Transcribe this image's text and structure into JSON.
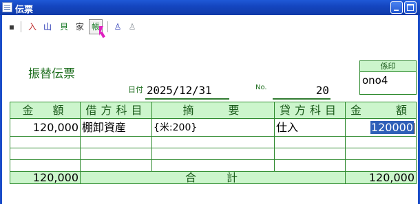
{
  "window": {
    "title": "伝票"
  },
  "toolbar": {
    "tools": [
      {
        "glyph": "▪",
        "icon": "new-sheet-icon"
      },
      {
        "glyph": "⼊",
        "icon": "entry-icon"
      },
      {
        "glyph": "⼭",
        "icon": "mountain-icon"
      },
      {
        "glyph": "⾙",
        "icon": "shell-icon"
      },
      {
        "glyph": "家",
        "icon": "house-icon"
      },
      {
        "glyph": "帳",
        "icon": "ledger-icon"
      },
      {
        "glyph": "♙",
        "icon": "user-icon"
      },
      {
        "glyph": "♙",
        "icon": "user-disabled-icon"
      }
    ]
  },
  "voucher": {
    "title": "振替伝票",
    "date_label": "日付",
    "date": "2025/12/31",
    "no_label": "No.",
    "number": "20",
    "stamp_label": "係印",
    "stamp_value": "ono4"
  },
  "table": {
    "headers": [
      "金　額",
      "借方科目",
      "摘　　要",
      "貸方科目",
      "金　　額"
    ],
    "rows": [
      {
        "debit_amount": "120,000",
        "debit_account": "棚卸資産",
        "description": "{米:200}",
        "credit_account": "仕入",
        "credit_amount": "120000"
      },
      {
        "debit_amount": "",
        "debit_account": "",
        "description": "",
        "credit_account": "",
        "credit_amount": ""
      },
      {
        "debit_amount": "",
        "debit_account": "",
        "description": "",
        "credit_account": "",
        "credit_amount": ""
      },
      {
        "debit_amount": "",
        "debit_account": "",
        "description": "",
        "credit_account": "",
        "credit_amount": ""
      }
    ],
    "total_label": "合　　計",
    "debit_total": "120,000",
    "credit_total": "120,000"
  },
  "colors": {
    "accent_green": "#1e7a1e",
    "header_fill": "#ccf5cc",
    "selection": "#2e5fb8",
    "titlebar": "#1546c0"
  }
}
